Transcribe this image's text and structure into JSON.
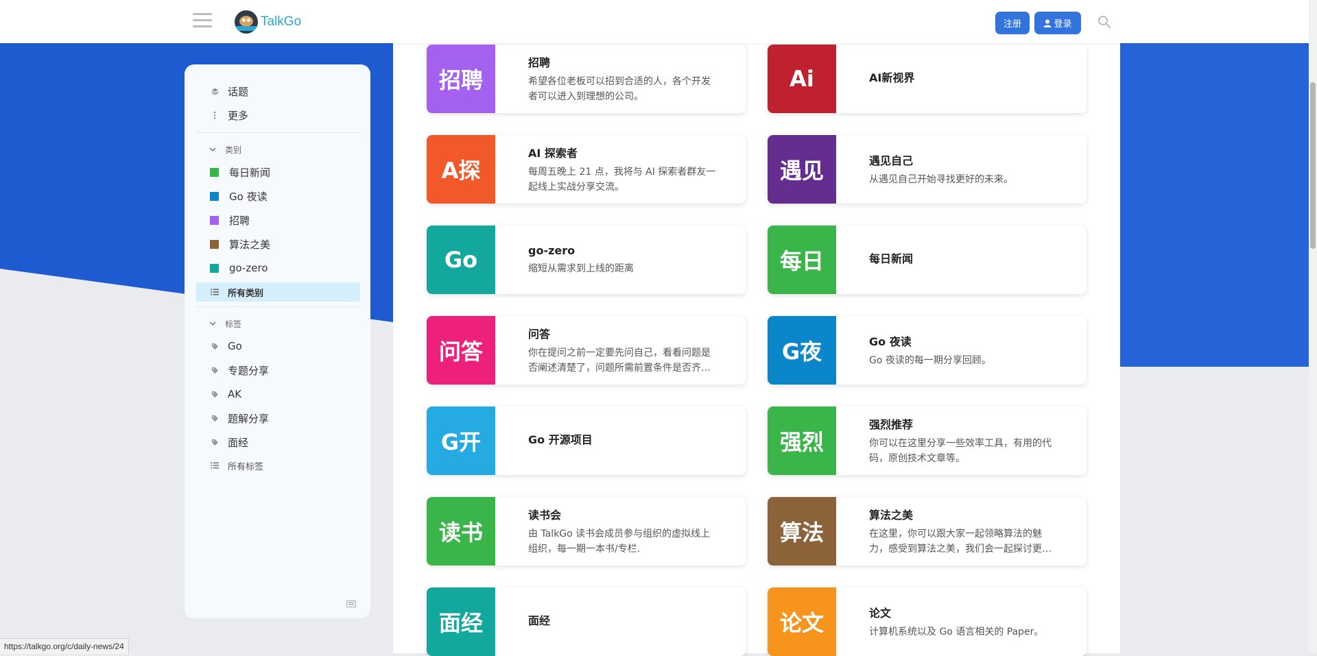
{
  "header": {
    "brand": "TalkGo",
    "signup_label": "注册",
    "login_label": "登录"
  },
  "sidebar": {
    "top_items": [
      {
        "label": "话题",
        "icon": "layers-icon"
      },
      {
        "label": "更多",
        "icon": "vertical-dots-icon"
      }
    ],
    "categories_header": "类别",
    "categories": [
      {
        "label": "每日新闻",
        "color": "#3ab54a"
      },
      {
        "label": "Go 夜读",
        "color": "#0b86ca"
      },
      {
        "label": "招聘",
        "color": "#a461ef"
      },
      {
        "label": "算法之美",
        "color": "#8c6238"
      },
      {
        "label": "go-zero",
        "color": "#12a89d"
      }
    ],
    "all_categories": "所有类别",
    "tags_header": "标签",
    "tags": [
      {
        "label": "Go"
      },
      {
        "label": "专题分享"
      },
      {
        "label": "AK"
      },
      {
        "label": "题解分享"
      },
      {
        "label": "面经"
      }
    ],
    "all_tags": "所有标签"
  },
  "cards": [
    {
      "badge": "招聘",
      "title": "招聘",
      "desc": "希望各位老板可以招到合适的人，各个开发者可以进入到理想的公司。",
      "color": "#a461ef"
    },
    {
      "badge": "Ai",
      "title": "AI新视界",
      "desc": "",
      "color": "#c0212f"
    },
    {
      "badge": "A探",
      "title": "AI 探索者",
      "desc": "每周五晚上 21 点，我将与 AI 探索者群友一起线上实战分享交流。",
      "color": "#f1592a"
    },
    {
      "badge": "遇见",
      "title": "遇见自己",
      "desc": "从遇见自己开始寻找更好的未来。",
      "color": "#652d90"
    },
    {
      "badge": "Go",
      "title": "go-zero",
      "desc": "缩短从需求到上线的距离",
      "color": "#12a89d"
    },
    {
      "badge": "每日",
      "title": "每日新闻",
      "desc": "",
      "color": "#3ab54a"
    },
    {
      "badge": "问答",
      "title": "问答",
      "desc": "你在提问之前一定要先问自己，看看问题是否阐述清楚了，问题所需前置条件是否齐全。",
      "color": "#ed207b"
    },
    {
      "badge": "G夜",
      "title": "Go 夜读",
      "desc": "Go 夜读的每一期分享回顾。",
      "color": "#0b86ca"
    },
    {
      "badge": "G开",
      "title": "Go 开源项目",
      "desc": "",
      "color": "#25aae1"
    },
    {
      "badge": "强烈",
      "title": "强烈推荐",
      "desc": "你可以在这里分享一些效率工具，有用的代码，原创技术文章等。",
      "color": "#3ab54a"
    },
    {
      "badge": "读书",
      "title": "读书会",
      "desc": "由 TalkGo 读书会成员参与组织的虚拟线上组织，每一期一本书/专栏.",
      "color": "#3ab54a"
    },
    {
      "badge": "算法",
      "title": "算法之美",
      "desc": "在这里，你可以跟大家一起领略算法的魅力，感受到算法之美，我们会一起探讨更多的问题。",
      "color": "#8c6238"
    },
    {
      "badge": "面经",
      "title": "面经",
      "desc": "",
      "color": "#12a89d"
    },
    {
      "badge": "论文",
      "title": "论文",
      "desc": "计算机系统以及 Go 语言相关的 Paper。",
      "color": "#f7941d"
    }
  ],
  "status_url": "https://talkgo.org/c/daily-news/24",
  "colors": {
    "brand": "#2aa7d8",
    "primary_button": "#3373dc",
    "bg_blue": "#1f5bd0",
    "active_item": "#d4eefb"
  }
}
